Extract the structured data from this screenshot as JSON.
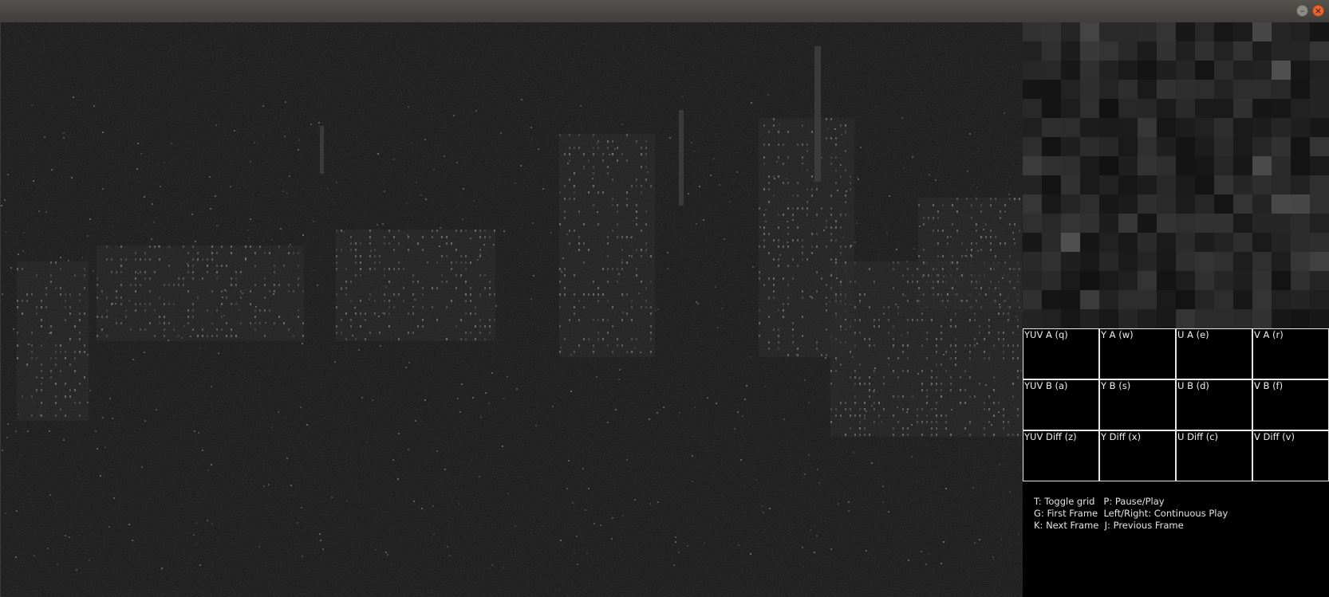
{
  "window": {
    "minimize_glyph": "–",
    "close_glyph": "×",
    "close_color": "#e9652f"
  },
  "main_view": {
    "icon": "video-frame",
    "background": "#101010"
  },
  "zoom_view": {
    "icon": "zoomed-pixel-block",
    "grid_size": 16
  },
  "channels": [
    {
      "id": "yuv-a",
      "label": "YUV A (q)"
    },
    {
      "id": "y-a",
      "label": "Y A (w)"
    },
    {
      "id": "u-a",
      "label": "U A (e)"
    },
    {
      "id": "v-a",
      "label": "V A (r)"
    },
    {
      "id": "yuv-b",
      "label": "YUV B (a)"
    },
    {
      "id": "y-b",
      "label": "Y B (s)"
    },
    {
      "id": "u-b",
      "label": "U B (d)"
    },
    {
      "id": "v-b",
      "label": "V B (f)"
    },
    {
      "id": "yuv-diff",
      "label": "YUV Diff (z)"
    },
    {
      "id": "y-diff",
      "label": "Y Diff (x)"
    },
    {
      "id": "u-diff",
      "label": "U Diff (c)"
    },
    {
      "id": "v-diff",
      "label": "V Diff (v)"
    }
  ],
  "help": [
    "T: Toggle grid   P: Pause/Play",
    "G: First Frame  Left/Right: Continuous Play",
    "K: Next Frame  J: Previous Frame"
  ]
}
